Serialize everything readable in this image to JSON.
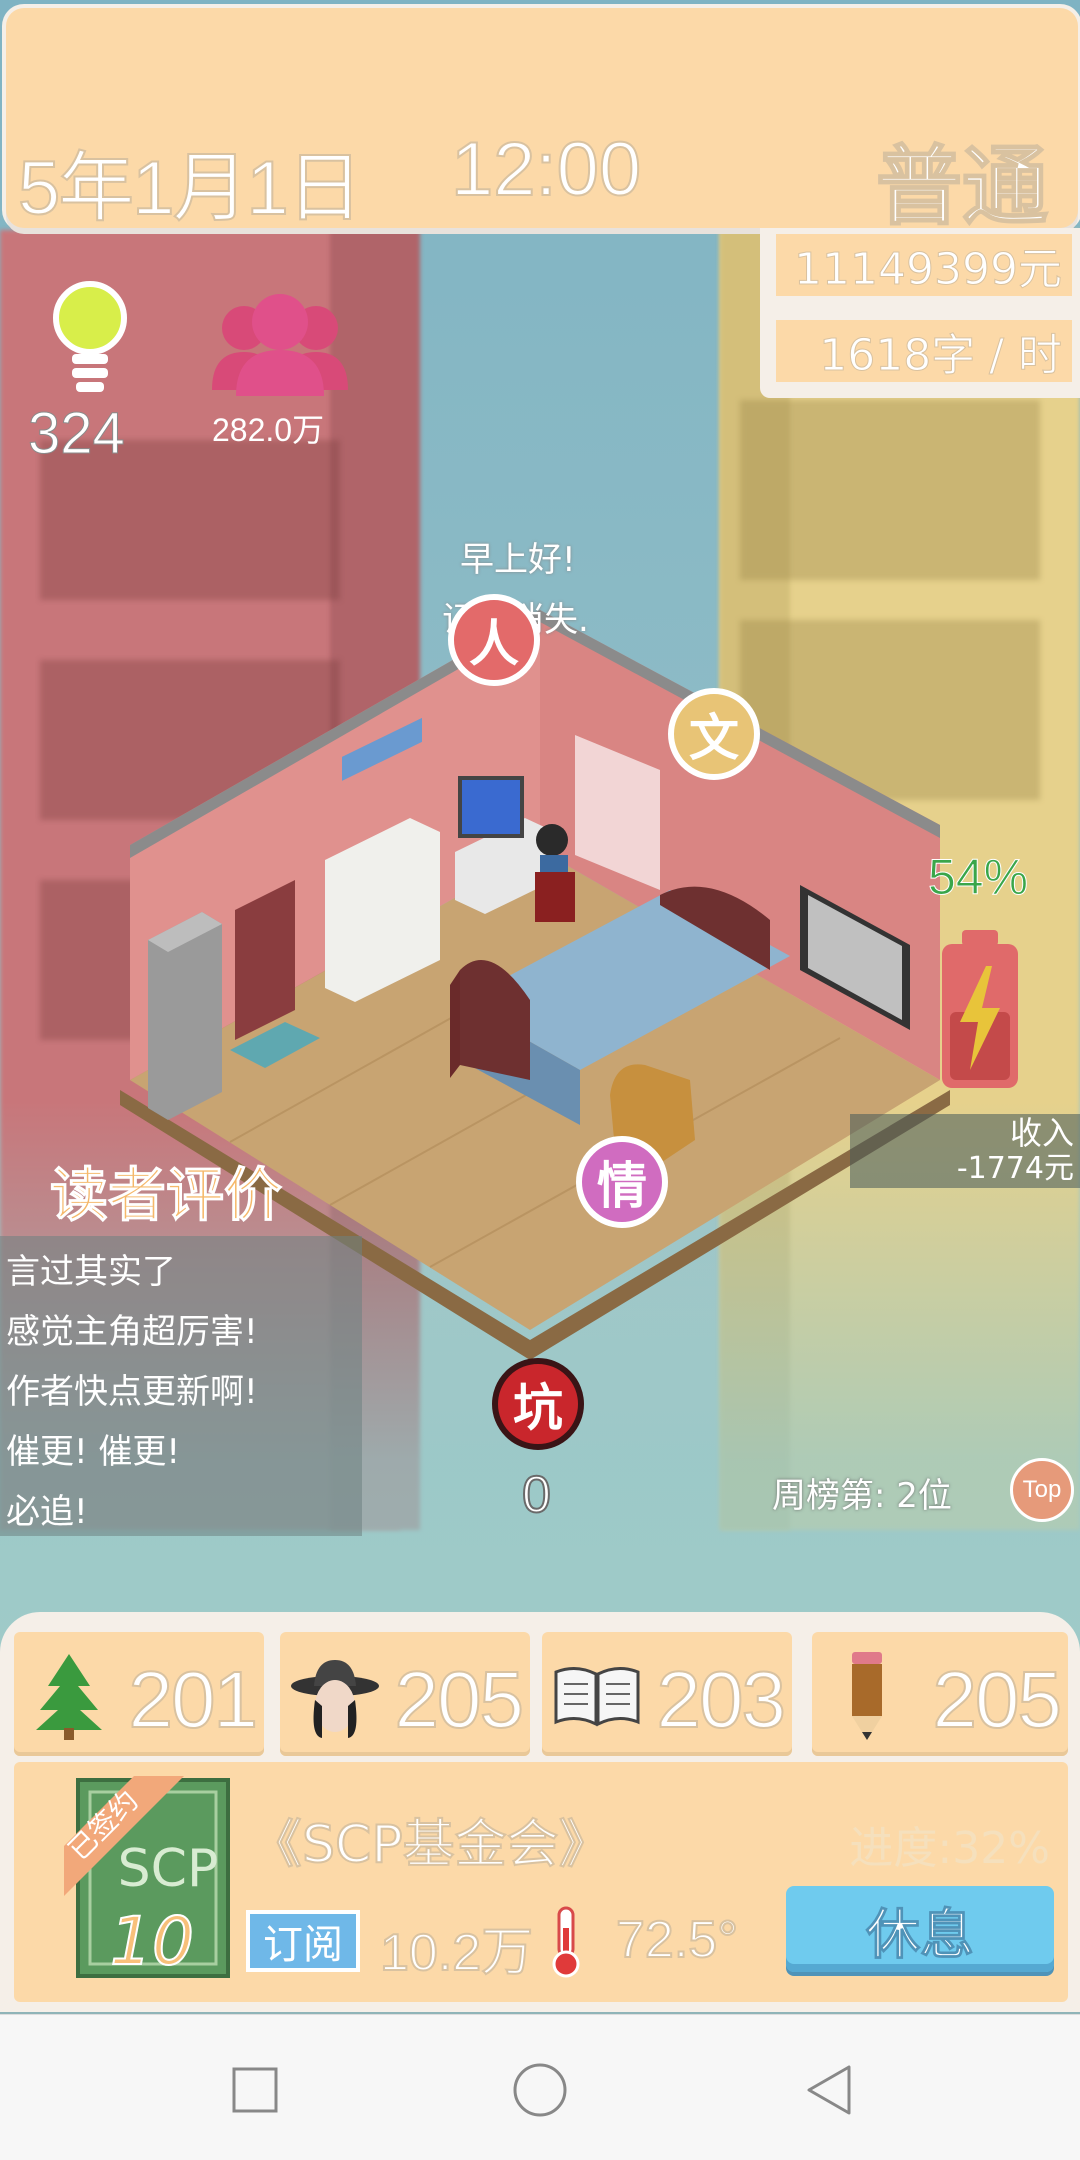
{
  "header": {
    "date": "5年1月1日",
    "time": "12:00",
    "difficulty": "普通"
  },
  "stats": {
    "money": "11149399元",
    "speed": "1618字 / 时",
    "inspiration": "324",
    "fans": "282.0万"
  },
  "greeting": {
    "line1": "早上好!",
    "line2": "证据消失."
  },
  "markers": {
    "ren": "人",
    "wen": "文",
    "qing": "情",
    "keng": "坑",
    "keng_count": "0"
  },
  "battery": {
    "percent": "54%",
    "level": 0.54
  },
  "income": {
    "label": "收入",
    "value": "-1774元"
  },
  "reviews": {
    "title": "读者评价",
    "items": [
      "言过其实了",
      "感觉主角超厉害!",
      "作者快点更新啊!",
      "催更! 催更!",
      "必追!"
    ]
  },
  "rank": {
    "text": "周榜第: 2位",
    "top_label": "Top"
  },
  "attributes": [
    {
      "icon": "tree-icon",
      "value": "201"
    },
    {
      "icon": "detective-hat-icon",
      "value": "205"
    },
    {
      "icon": "open-book-icon",
      "value": "203"
    },
    {
      "icon": "pencil-icon",
      "value": "205"
    }
  ],
  "book": {
    "badge": "已签约",
    "cover_text": "SCP",
    "cover_number": "10",
    "title": "《SCP基金会》",
    "progress": "进度:32%",
    "subscribe_label": "订阅",
    "subscribers": "10.2万",
    "heat": "72.5°",
    "rest_button": "休息"
  },
  "colors": {
    "panel": "#fcd9a8",
    "panel_border": "#f5efe8",
    "accent_blue": "#6fcbee",
    "battery_green": "#3aa64a",
    "review_title": "#f5b86a"
  }
}
